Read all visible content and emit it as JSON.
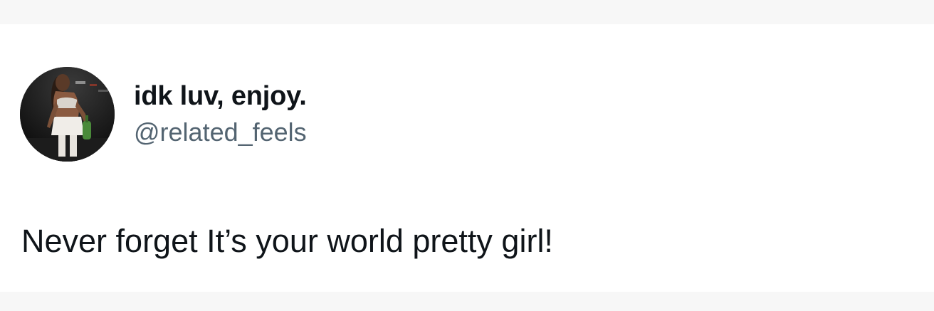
{
  "tweet": {
    "display_name": "idk luv, enjoy.",
    "handle": "@related_feels",
    "text": "Never forget It’s your world pretty girl!"
  },
  "colors": {
    "page_background": "#f7f7f7",
    "card_background": "#ffffff",
    "name_text": "#0f1419",
    "handle_text": "#536471"
  }
}
